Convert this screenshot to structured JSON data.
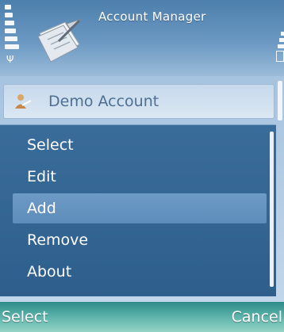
{
  "header": {
    "title": "Account Manager",
    "app_icon": "notepad-pen-icon",
    "signal_icon": "signal-strength-icon",
    "battery_icon": "battery-level-icon"
  },
  "list": {
    "items": [
      {
        "label": "Demo Account",
        "icon": "user-icon"
      }
    ]
  },
  "options_menu": {
    "items": [
      {
        "label": "Select"
      },
      {
        "label": "Edit"
      },
      {
        "label": "Add",
        "highlighted": true
      },
      {
        "label": "Remove"
      },
      {
        "label": "About"
      }
    ]
  },
  "softkeys": {
    "left": "Select",
    "right": "Cancel"
  },
  "colors": {
    "menu_background": "#2e5f8c",
    "menu_highlight": "#6d9ac6",
    "softkey_bar": "#58b0a8"
  }
}
